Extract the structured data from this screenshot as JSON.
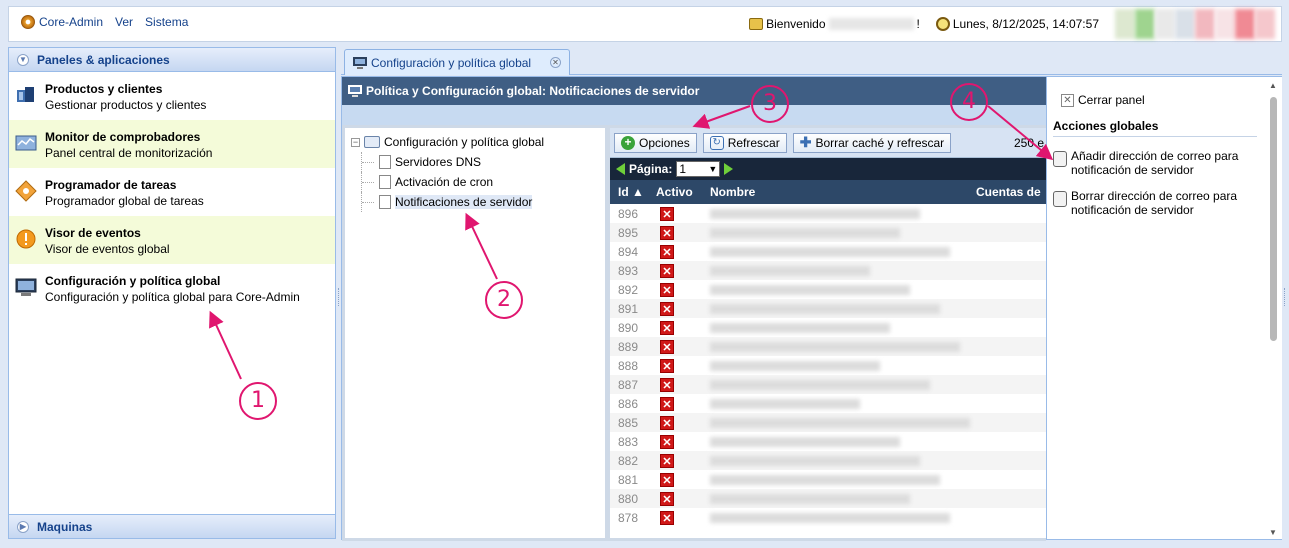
{
  "menu": {
    "app": "Core-Admin",
    "view": "Ver",
    "system": "Sistema"
  },
  "top": {
    "welcome": "Bienvenido",
    "welcome_end": "!",
    "datetime": "Lunes, 8/12/2025, 14:07:57"
  },
  "left": {
    "header": "Paneles & aplicaciones",
    "items": [
      {
        "title": "Productos y clientes",
        "subtitle": "Gestionar productos y clientes"
      },
      {
        "title": "Monitor de comprobadores",
        "subtitle": "Panel central de monitorización"
      },
      {
        "title": "Programador de tareas",
        "subtitle": "Programador global de tareas"
      },
      {
        "title": "Visor de eventos",
        "subtitle": "Visor de eventos global"
      },
      {
        "title": "Configuración y política global",
        "subtitle": "Configuración y política global para Core-Admin"
      }
    ],
    "footer": "Maquinas"
  },
  "tab": {
    "label": "Configuración y política global"
  },
  "panel": {
    "title": "Política y Configuración global: Notificaciones de servidor"
  },
  "tree": {
    "root": "Configuración y política global",
    "children": [
      "Servidores DNS",
      "Activación de cron",
      "Notificaciones de servidor"
    ]
  },
  "toolbar": {
    "options": "Opciones",
    "refresh": "Refrescar",
    "clear_refresh": "Borrar caché y refrescar",
    "count": "250 e"
  },
  "pager": {
    "label": "Página:",
    "value": "1"
  },
  "grid": {
    "columns": {
      "id": "Id",
      "active": "Activo",
      "name": "Nombre",
      "accounts": "Cuentas de"
    },
    "ids": [
      "896",
      "895",
      "894",
      "893",
      "892",
      "891",
      "890",
      "889",
      "888",
      "887",
      "886",
      "885",
      "883",
      "882",
      "881",
      "880",
      "878"
    ]
  },
  "right": {
    "close": "Cerrar panel",
    "section": "Acciones globales",
    "actions": [
      "Añadir dirección de correo para notificación de servidor",
      "Borrar dirección de correo para notificación de servidor"
    ]
  },
  "annotations": [
    "1",
    "2",
    "3",
    "4"
  ]
}
